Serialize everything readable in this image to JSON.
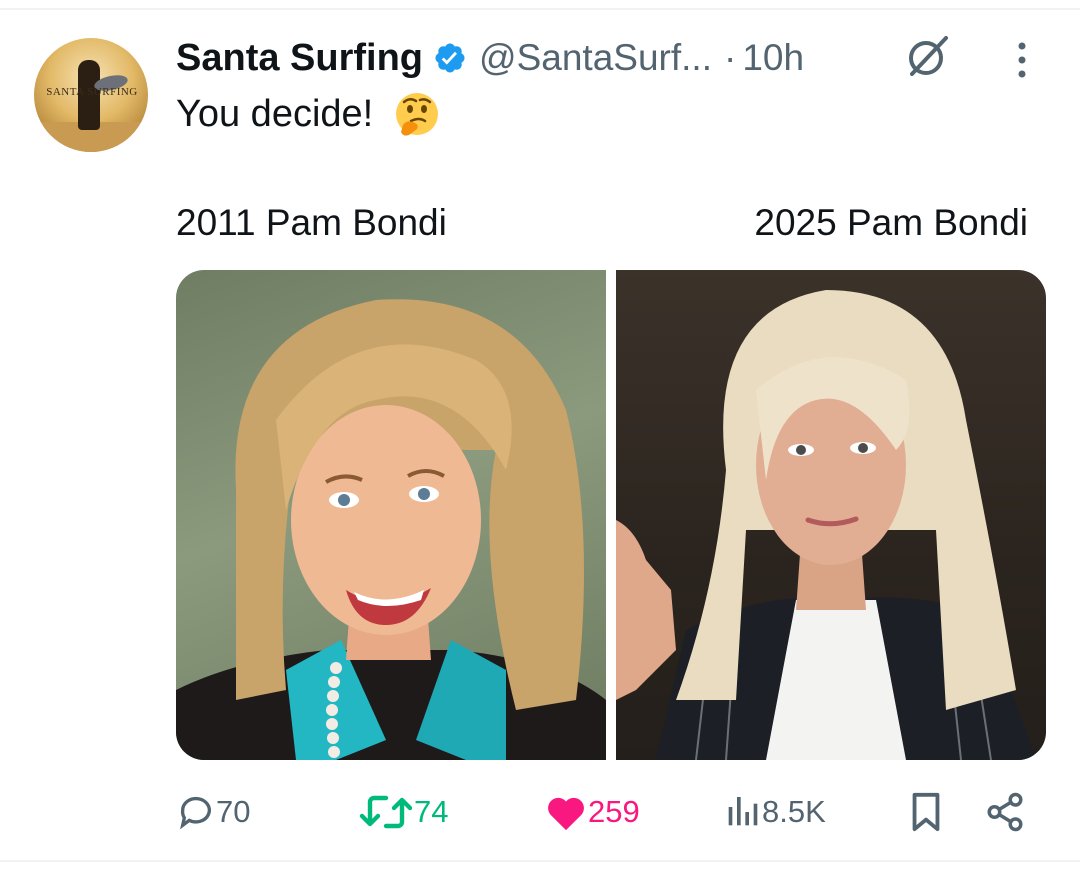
{
  "post": {
    "author": {
      "display_name": "Santa Surfing",
      "handle": "@SantaSurf...",
      "verified": true,
      "avatar_text": "SANTA SURFING"
    },
    "separator": "·",
    "timestamp": "10h",
    "text": "You decide!",
    "emoji": "thinking-face",
    "media": {
      "left_caption": "2011 Pam Bondi",
      "right_caption": "2025 Pam Bondi"
    },
    "metrics": {
      "replies": "70",
      "reposts": "74",
      "likes": "259",
      "views": "8.5K"
    }
  },
  "colors": {
    "text": "#0f1419",
    "secondary": "#536471",
    "verified": "#1d9bf0",
    "repost_active": "#00ba7c",
    "like_active": "#f91880",
    "divider": "#eff3f4"
  },
  "icons": [
    "verified-badge-icon",
    "grok-icon",
    "more-icon",
    "reply-icon",
    "repost-icon",
    "like-icon",
    "views-icon",
    "bookmark-icon",
    "share-icon"
  ]
}
